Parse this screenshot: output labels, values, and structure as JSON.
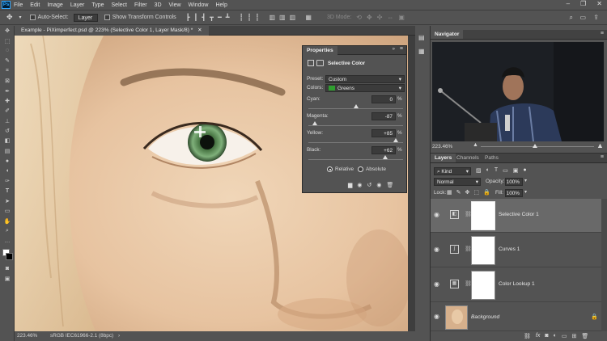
{
  "menubar": {
    "app_icon": "Ps",
    "items": [
      "File",
      "Edit",
      "Image",
      "Layer",
      "Type",
      "Select",
      "Filter",
      "3D",
      "View",
      "Window",
      "Help"
    ]
  },
  "options": {
    "auto_select_label": "Auto-Select:",
    "auto_select_value": "Layer",
    "show_transform_label": "Show Transform Controls",
    "mode_3d_label": "3D Mode:"
  },
  "document": {
    "tab_title": "Example - PiXimperfect.psd @ 223% (Selective Color 1, Layer Mask/8) *",
    "zoom": "223.46%",
    "color_profile": "sRGB IEC61966-2.1 (8bpc)"
  },
  "properties": {
    "tab": "Properties",
    "adjustment_title": "Selective Color",
    "preset_label": "Preset:",
    "preset_value": "Custom",
    "colors_label": "Colors:",
    "colors_value": "Greens",
    "colors_swatch": "#2f9e2f",
    "sliders": [
      {
        "label": "Cyan:",
        "value": "0",
        "unit": "%",
        "level": 0
      },
      {
        "label": "Magenta:",
        "value": "-87",
        "unit": "%",
        "level": -87
      },
      {
        "label": "Yellow:",
        "value": "+85",
        "unit": "%",
        "level": 85
      },
      {
        "label": "Black:",
        "value": "+62",
        "unit": "%",
        "level": 62
      }
    ],
    "method_relative": "Relative",
    "method_absolute": "Absolute",
    "method_selected": "Relative"
  },
  "navigator": {
    "tab": "Navigator",
    "zoom": "223.46%"
  },
  "layers_panel": {
    "tabs": [
      "Layers",
      "Channels",
      "Paths"
    ],
    "active_tab": "Layers",
    "filter_kind": "Kind",
    "blend_mode": "Normal",
    "opacity_label": "Opacity:",
    "opacity_value": "100%",
    "lock_label": "Lock:",
    "fill_label": "Fill:",
    "fill_value": "100%",
    "layers": [
      {
        "name": "Selective Color 1",
        "icon": "selective-color-icon",
        "selected": true
      },
      {
        "name": "Curves 1",
        "icon": "curves-icon",
        "selected": false
      },
      {
        "name": "Color Lookup 1",
        "icon": "color-lookup-icon",
        "selected": false
      },
      {
        "name": "Background",
        "icon": "photo-thumbnail",
        "selected": false
      }
    ]
  },
  "colors": {
    "accent": "#31a8ff",
    "panel": "#535353",
    "dark": "#424242",
    "selected_row": "#696969"
  }
}
